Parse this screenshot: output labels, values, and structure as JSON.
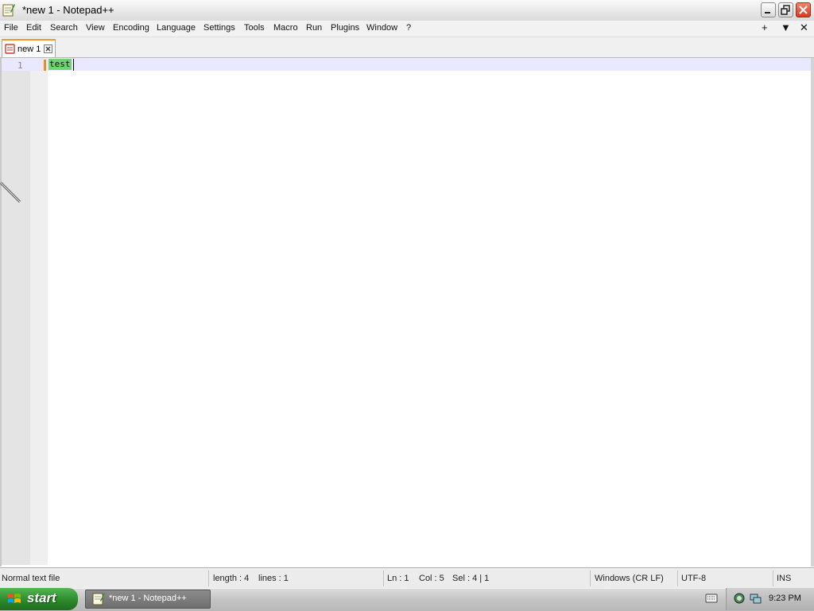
{
  "window": {
    "title": "*new 1 - Notepad++"
  },
  "menu": {
    "items": [
      "File",
      "Edit",
      "Search",
      "View",
      "Encoding",
      "Language",
      "Settings",
      "Tools",
      "Macro",
      "Run",
      "Plugins",
      "Window",
      "?"
    ],
    "right_buttons": [
      "+",
      "▼",
      "✕"
    ]
  },
  "tabs": [
    {
      "label": "new 1"
    }
  ],
  "editor": {
    "lines": [
      {
        "number": "1",
        "text": "test"
      }
    ],
    "colors": {
      "selection": "#6fd46f",
      "current_line": "#e8e8ff",
      "change_marker": "#f08c1a"
    }
  },
  "status": {
    "file_type": "Normal text file",
    "length": "length : 4",
    "lines": "lines : 1",
    "ln": "Ln : 1",
    "col": "Col : 5",
    "sel": "Sel : 4 | 1",
    "eol": "Windows (CR LF)",
    "encoding": "UTF-8",
    "mode": "INS"
  },
  "taskbar": {
    "start_label": "start",
    "task_label": "*new 1 - Notepad++",
    "clock": "9:23 PM"
  }
}
